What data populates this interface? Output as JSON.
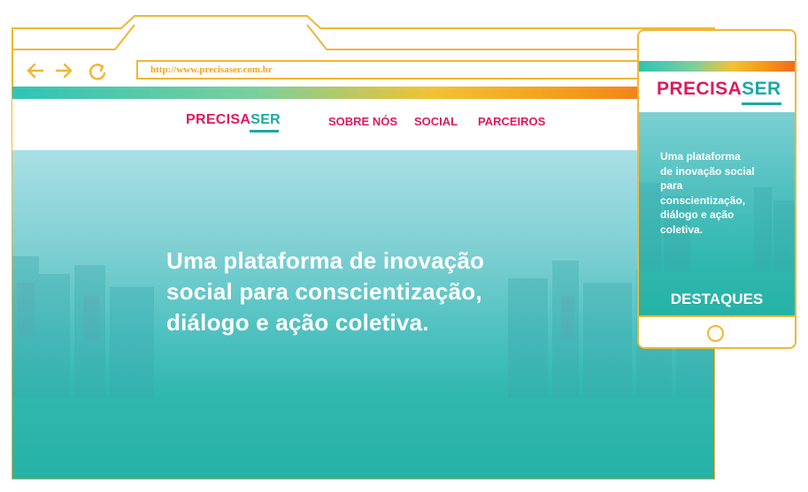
{
  "browser": {
    "url": "http://www.precisaser.com.br",
    "icons": [
      "back-arrow-icon",
      "forward-arrow-icon",
      "reload-icon"
    ]
  },
  "site": {
    "logo": {
      "part1": "PRECISA",
      "part2": "SER"
    },
    "nav": [
      "SOBRE NÓS",
      "SOCIAL",
      "PARCEIROS"
    ],
    "hero_lines": [
      "Uma plataforma de inovação",
      "social para conscientização,",
      "diálogo e ação coletiva."
    ]
  },
  "mobile": {
    "logo": {
      "part1": "PRECISA",
      "part2": "SER"
    },
    "hero_lines": [
      "Uma plataforma",
      "de inovação social",
      "para",
      "conscientização,",
      "diálogo e ação",
      "coletiva."
    ],
    "section_title": "DESTAQUES"
  },
  "colors": {
    "frame": "#f2b632",
    "brand_pink": "#e0195d",
    "brand_teal": "#1aa9a3",
    "hero_teal": "#26b2a6"
  }
}
